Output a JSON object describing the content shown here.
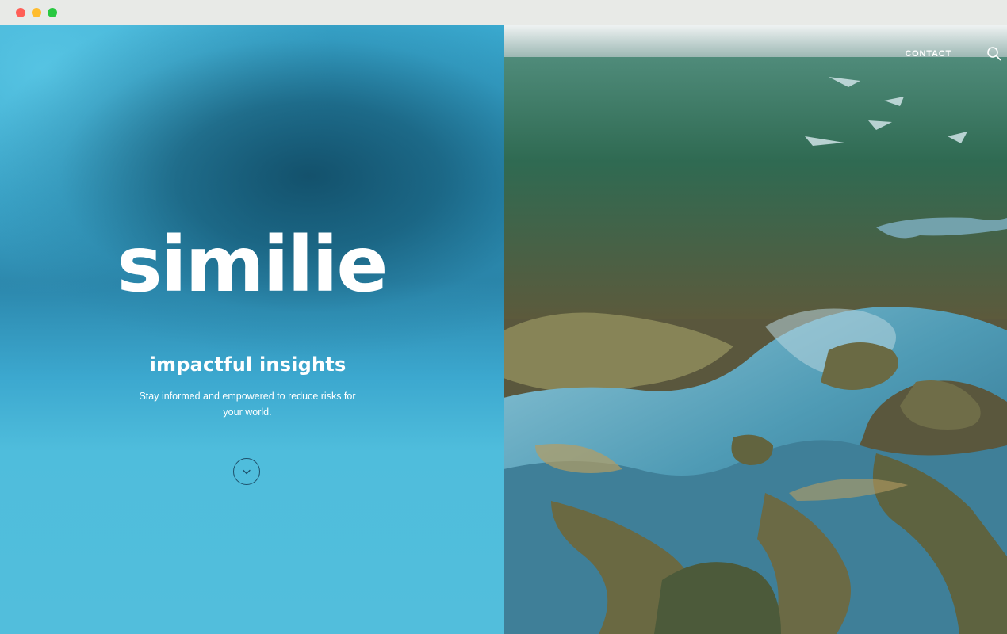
{
  "window": {
    "controls": [
      "close",
      "minimize",
      "zoom"
    ]
  },
  "hero": {
    "logo_text": "similie",
    "tagline": "impactful insights",
    "description": "Stay informed and empowered to reduce risks for your world.",
    "scroll_icon": "chevron-down-icon"
  },
  "nav": {
    "contact_label": "CONTACT",
    "search_icon": "search-icon"
  },
  "image": {
    "subject": "aerial-wetland-landscape"
  },
  "colors": {
    "panel_light": "#52bedc",
    "panel_dark": "#165a76",
    "text": "#ffffff",
    "scroll_ring": "#1d4f6a"
  }
}
